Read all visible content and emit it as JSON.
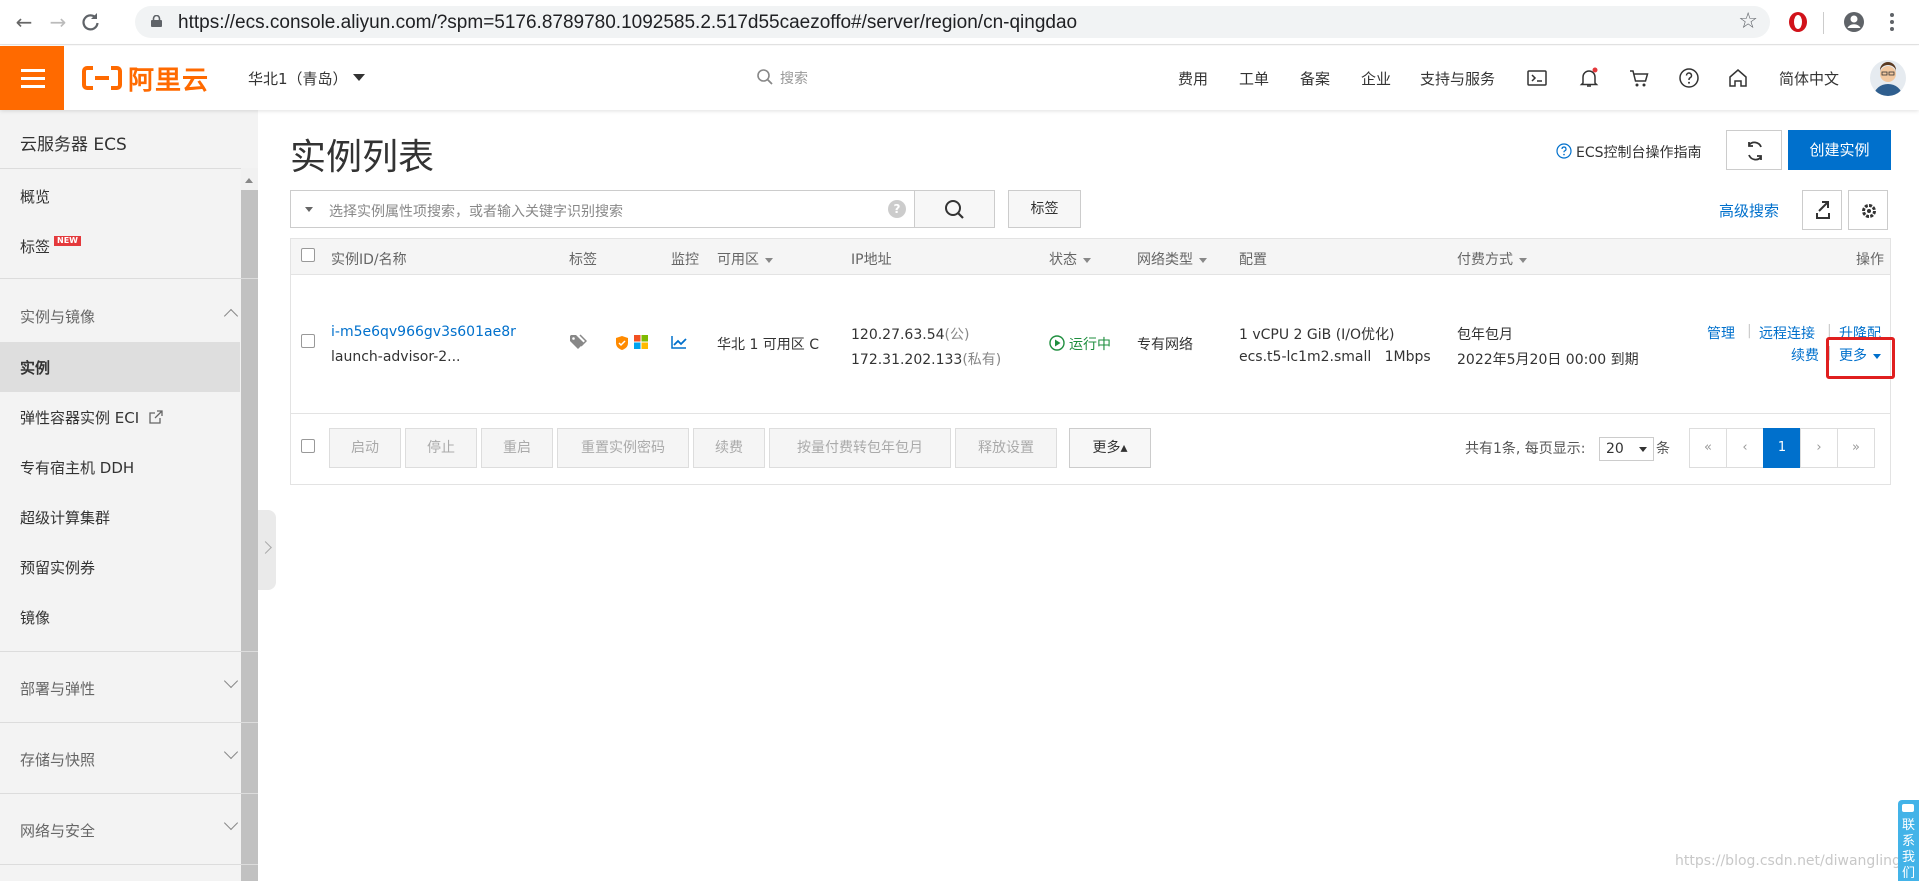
{
  "browser": {
    "url": "https://ecs.console.aliyun.com/?spm=5176.8789780.1092585.2.517d55caezoffo#/server/region/cn-qingdao"
  },
  "header": {
    "logo_text": "阿里云",
    "region": "华北1（青岛）",
    "search_placeholder": "搜索",
    "nav": [
      "费用",
      "工单",
      "备案",
      "企业",
      "支持与服务"
    ],
    "language": "简体中文",
    "brand_color": "#ff6a00"
  },
  "sidebar": {
    "title": "云服务器 ECS",
    "items_top": [
      "概览",
      "标签"
    ],
    "new_badge": "NEW",
    "group_instances": "实例与镜像",
    "items_instances": [
      "实例",
      "弹性容器实例 ECI",
      "专有宿主机 DDH",
      "超级计算集群",
      "预留实例券",
      "镜像"
    ],
    "groups_collapsed": [
      "部署与弹性",
      "存储与快照",
      "网络与安全"
    ],
    "active_item": "实例"
  },
  "main": {
    "title": "实例列表",
    "guide_link": "ECS控制台操作指南",
    "create_button": "创建实例",
    "search_placeholder": "选择实例属性项搜索，或者输入关键字识别搜索",
    "tag_button": "标签",
    "advanced_search": "高级搜索",
    "accent_color": "#0070cc"
  },
  "table": {
    "headers": {
      "id": "实例ID/名称",
      "tag": "标签",
      "monitor": "监控",
      "zone": "可用区",
      "ip": "IP地址",
      "status": "状态",
      "network": "网络类型",
      "config": "配置",
      "billing": "付费方式",
      "ops": "操作"
    },
    "row": {
      "instance_id": "i-m5e6qv966gv3s601ae8r",
      "instance_name": "launch-advisor-2...",
      "zone": "华北 1 可用区 C",
      "public_ip": "120.27.63.54",
      "public_label": "(公)",
      "private_ip": "172.31.202.133",
      "private_label": "(私有)",
      "status": "运行中",
      "network": "专有网络",
      "config_line1": "1 vCPU 2 GiB (I/O优化)",
      "config_line2": "ecs.t5-lc1m2.small   1Mbps",
      "billing_line1": "包年包月",
      "billing_line2": "2022年5月20日 00:00 到期",
      "ops": [
        "管理",
        "远程连接",
        "升降配",
        "续费",
        "更多"
      ]
    },
    "footer_buttons": [
      "启动",
      "停止",
      "重启",
      "重置实例密码",
      "续费",
      "按量付费转包年包月",
      "释放设置",
      "更多▴"
    ],
    "total_text": "共有1条, 每页显示:",
    "page_size": "20",
    "page_size_unit": "条",
    "pagination": [
      "«",
      "‹",
      "1",
      "›",
      "»"
    ]
  },
  "watermark": "https://blog.csdn.net/diwangling...",
  "contact_tab": "联系我们"
}
